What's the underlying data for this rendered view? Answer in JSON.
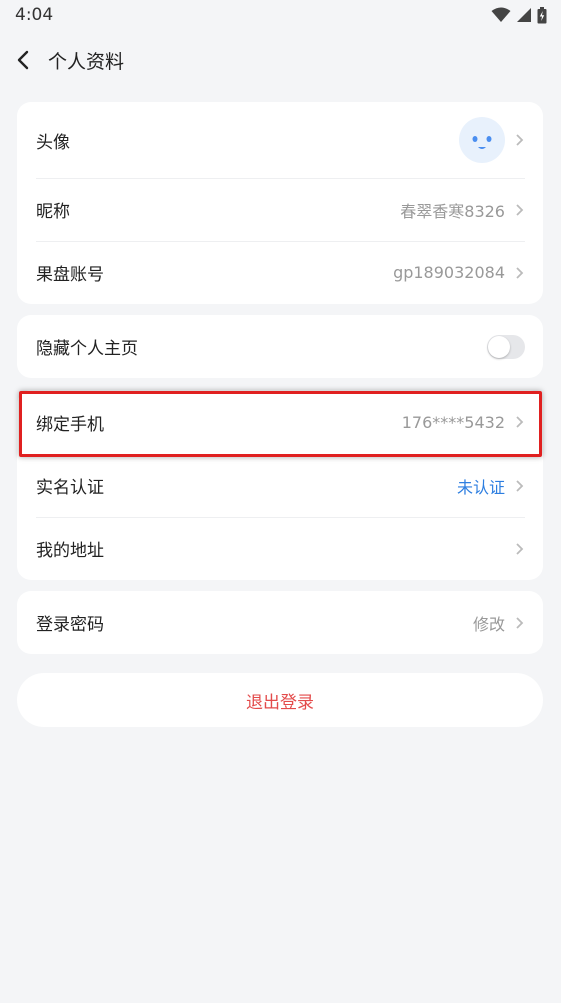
{
  "status": {
    "time": "4:04"
  },
  "nav": {
    "title": "个人资料"
  },
  "profile": {
    "avatar_label": "头像",
    "nickname_label": "昵称",
    "nickname_value": "春翠香寒8326",
    "account_label": "果盘账号",
    "account_value": "gp189032084"
  },
  "privacy": {
    "hide_homepage_label": "隐藏个人主页",
    "hide_homepage_on": false
  },
  "security": {
    "phone_label": "绑定手机",
    "phone_value": "176****5432",
    "realname_label": "实名认证",
    "realname_value": "未认证",
    "address_label": "我的地址"
  },
  "password": {
    "label": "登录密码",
    "value": "修改"
  },
  "logout_label": "退出登录",
  "colors": {
    "background": "#f4f5f7",
    "accent_blue": "#2d7ee0",
    "logout_red": "#e34b4b",
    "highlight_red": "#e02020"
  }
}
